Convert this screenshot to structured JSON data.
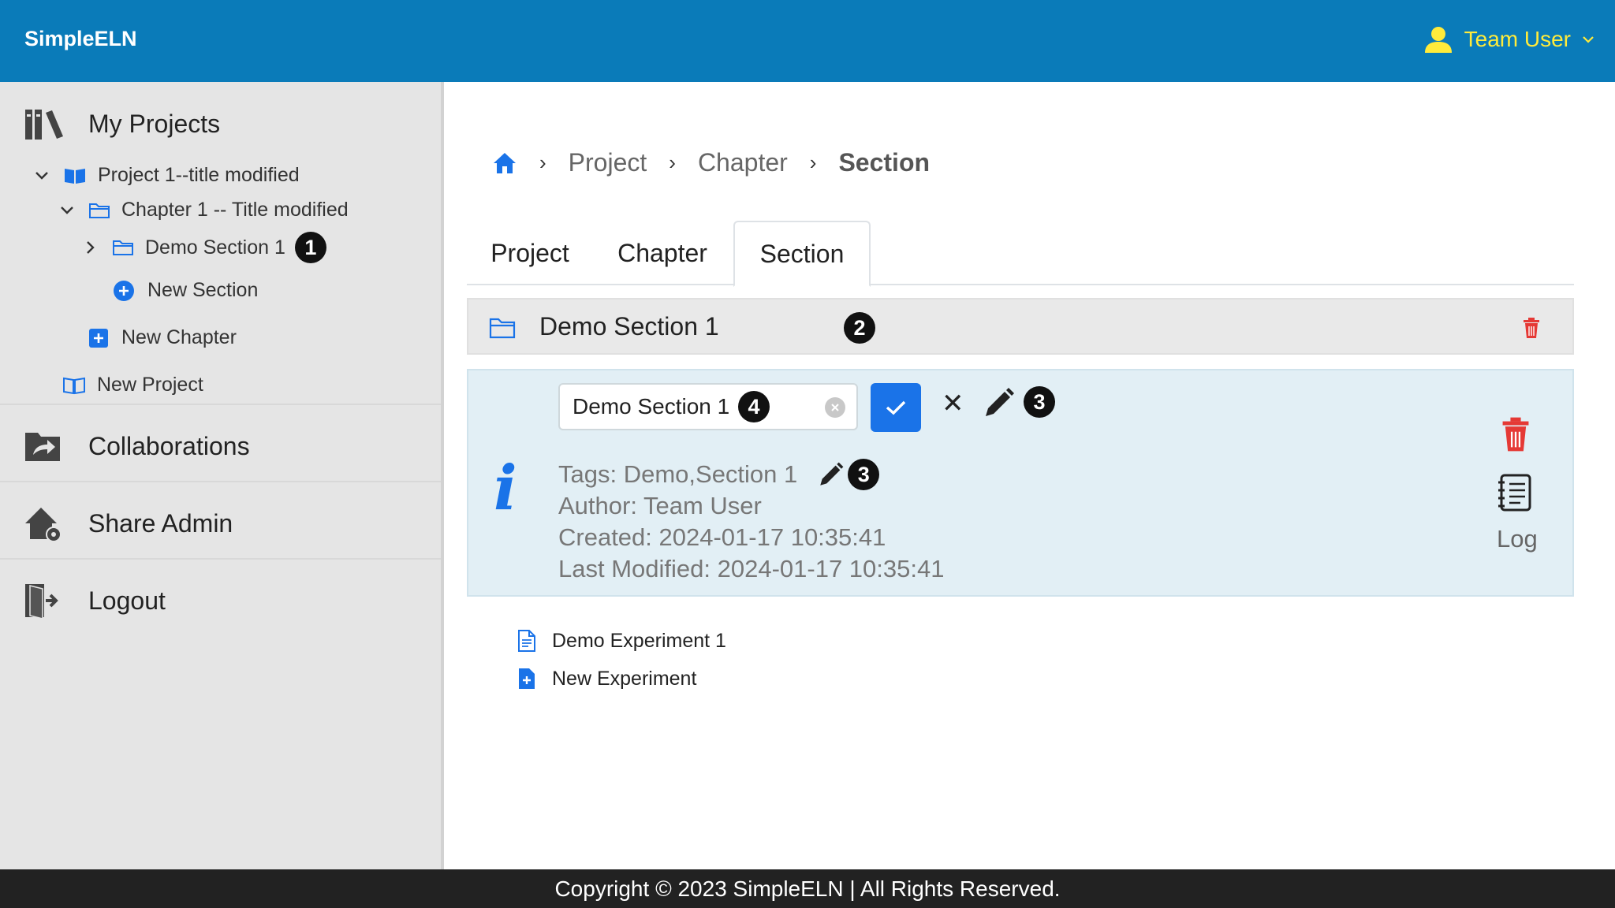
{
  "app": {
    "brand": "SimpleELN",
    "user_name": "Team User"
  },
  "sidebar": {
    "my_projects": "My Projects",
    "collaborations": "Collaborations",
    "share_admin": "Share Admin",
    "logout": "Logout",
    "tree": {
      "project": "Project 1--title modified",
      "chapter": "Chapter 1 -- Title modified",
      "section": "Demo Section 1",
      "new_section": "New Section",
      "new_chapter": "New Chapter",
      "new_project": "New Project"
    }
  },
  "breadcrumb": {
    "project": "Project",
    "chapter": "Chapter",
    "current": "Section"
  },
  "tabs": [
    "Project",
    "Chapter",
    "Section"
  ],
  "section": {
    "title": "Demo Section 1",
    "edit_value": "Demo Section 1",
    "tags": "Tags: Demo,Section 1",
    "author": "Author:  Team User",
    "created": "Created:  2024-01-17 10:35:41",
    "modified": "Last Modified:  2024-01-17 10:35:41",
    "log_label": "Log",
    "cancel_symbol": "✕"
  },
  "experiments": {
    "items": [
      "Demo Experiment 1"
    ],
    "new": "New Experiment"
  },
  "annotations": {
    "b1": "1",
    "b2": "2",
    "b3": "3",
    "b4": "4"
  },
  "footer": {
    "text": "Copyright © 2023 SimpleELN | All Rights Reserved."
  },
  "colors": {
    "header": "#0a7bb9",
    "accent": "#1a73e8",
    "user": "#ffeb3b",
    "danger": "#e53935",
    "panel": "#e2eff5"
  }
}
